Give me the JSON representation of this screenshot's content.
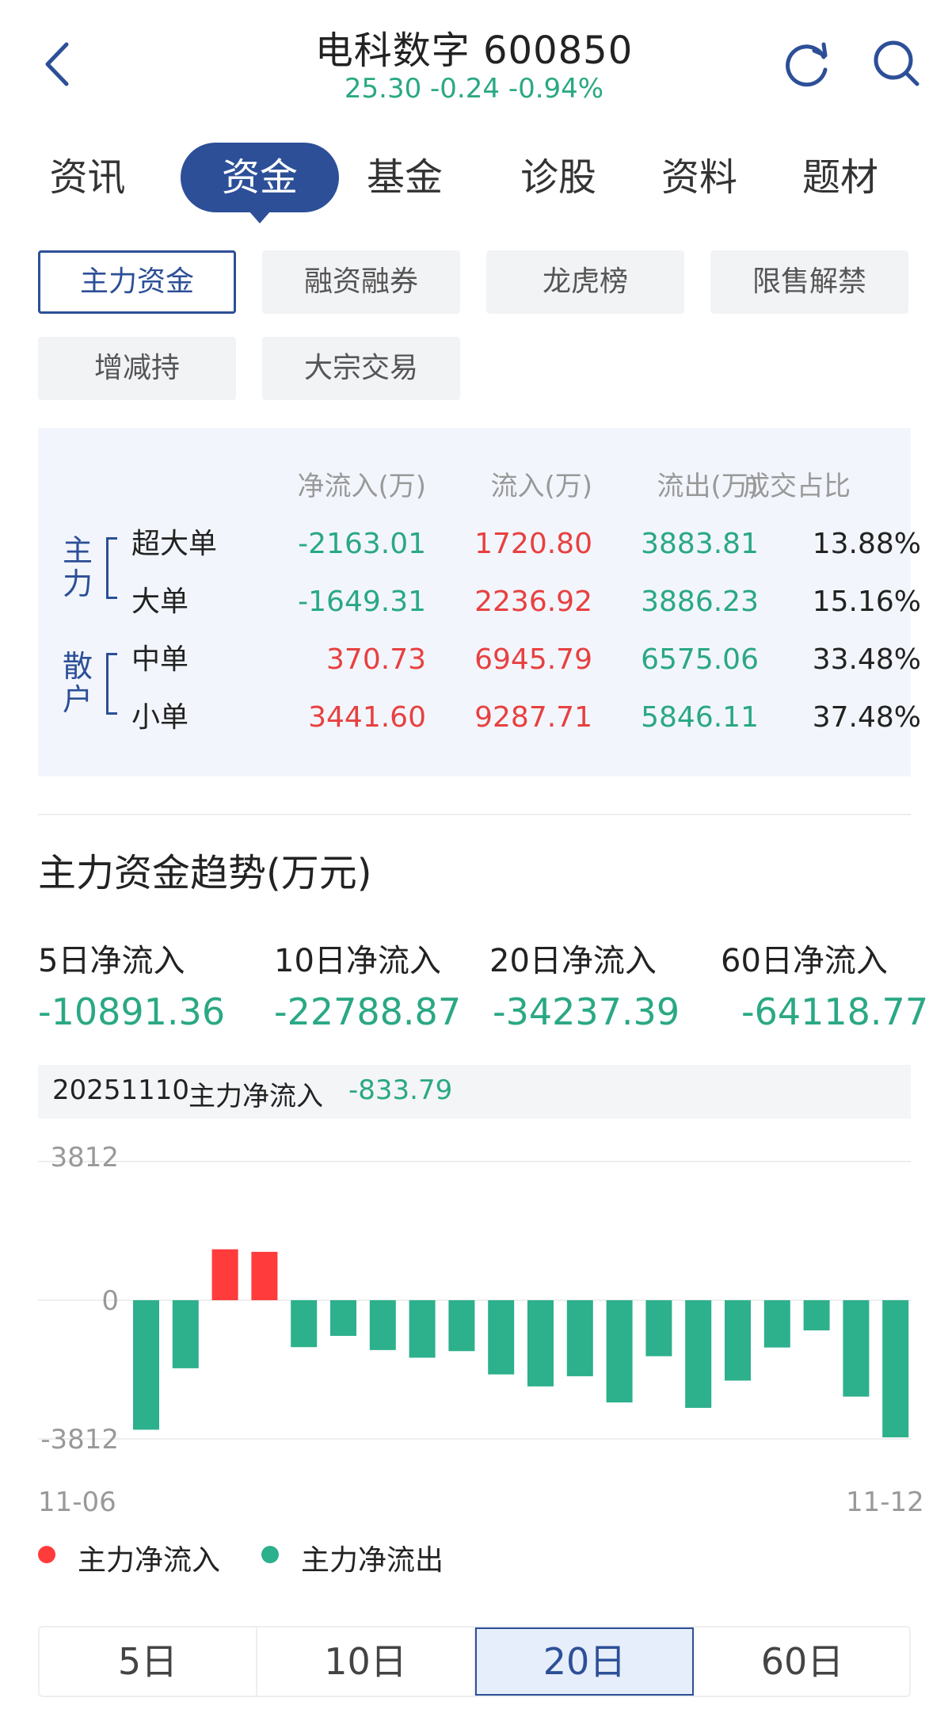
{
  "header": {
    "title": "电科数字 600850",
    "price_line": "25.30  -0.24  -0.94%",
    "back_icon": "back-arrow-icon",
    "refresh_icon": "refresh-icon",
    "search_icon": "search-icon"
  },
  "main_tabs": [
    "资讯",
    "资金",
    "基金",
    "诊股",
    "资料",
    "题材"
  ],
  "main_tab_active": "资金",
  "sub_tabs": [
    "主力资金",
    "融资融券",
    "龙虎榜",
    "限售解禁",
    "增减持",
    "大宗交易"
  ],
  "sub_tab_active": "主力资金",
  "fund_table": {
    "headers": [
      "净流入(万)",
      "流入(万)",
      "流出(万)",
      "成交占比"
    ],
    "groups": [
      {
        "label": "主力",
        "rows": [
          {
            "name": "超大单",
            "net": "-2163.01",
            "in": "1720.80",
            "out": "3883.81",
            "ratio": "13.88%"
          },
          {
            "name": "大单",
            "net": "-1649.31",
            "in": "2236.92",
            "out": "3886.23",
            "ratio": "15.16%"
          }
        ]
      },
      {
        "label": "散户",
        "rows": [
          {
            "name": "中单",
            "net": "370.73",
            "in": "6945.79",
            "out": "6575.06",
            "ratio": "33.48%"
          },
          {
            "name": "小单",
            "net": "3441.60",
            "in": "9287.71",
            "out": "5846.11",
            "ratio": "37.48%"
          }
        ]
      }
    ]
  },
  "trend": {
    "title": "主力资金趋势(万元)",
    "periods": [
      {
        "label": "5日净流入",
        "value": "-10891.36"
      },
      {
        "label": "10日净流入",
        "value": "-22788.87"
      },
      {
        "label": "20日净流入",
        "value": "-34237.39"
      },
      {
        "label": "60日净流入",
        "value": "-64118.77"
      }
    ],
    "info": {
      "date": "20251110",
      "label": "主力净流入",
      "value": "-833.79"
    }
  },
  "chart_data": {
    "type": "bar",
    "y_ticks": [
      "3812",
      "0",
      "-3812"
    ],
    "ylim": [
      -3812,
      3812
    ],
    "x_start_label": "11-06",
    "x_end_label": "11-12",
    "values": [
      -3560,
      -1870,
      1400,
      1330,
      -1290,
      -980,
      -1370,
      -1580,
      -1400,
      -2040,
      -2370,
      -2090,
      -2810,
      -1540,
      -2960,
      -2210,
      -1300,
      -830,
      -2650,
      -3770
    ],
    "positive_color": "#ff3b3b",
    "negative_color": "#2db08c",
    "legend": [
      {
        "label": "主力净流入",
        "color": "#ff3b3b"
      },
      {
        "label": "主力净流出",
        "color": "#2db08c"
      }
    ]
  },
  "period_tabs": [
    "5日",
    "10日",
    "20日",
    "60日"
  ],
  "period_tab_active": "20日",
  "colors": {
    "accent": "#2c4f97",
    "up": "#e84040",
    "down": "#2aa884"
  }
}
